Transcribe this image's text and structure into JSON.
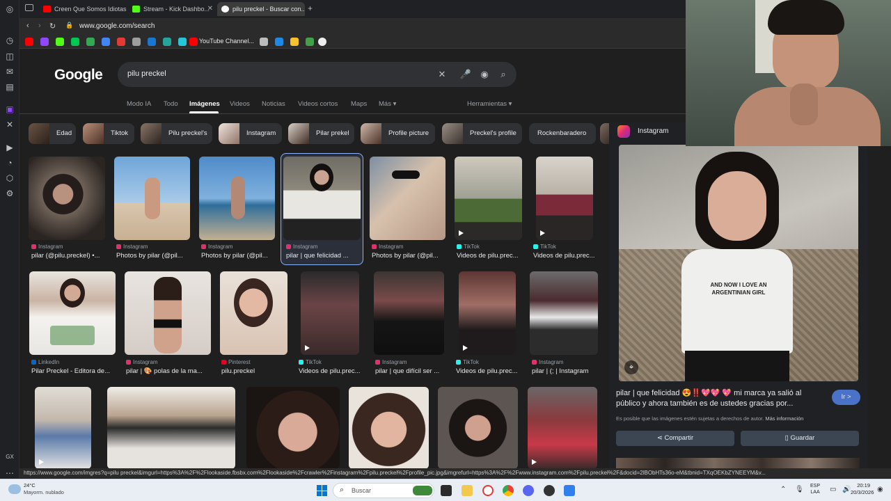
{
  "tabs": [
    {
      "title": "Creen Que Somos Idiotas"
    },
    {
      "title": "Stream - Kick Dashbo..."
    },
    {
      "title": "pilu preckel - Buscar con..."
    }
  ],
  "address_bar": {
    "url": "www.google.com/search"
  },
  "bookmarks": {
    "youtube_label": "YouTube Channel..."
  },
  "google": {
    "logo": "Google",
    "query": "pilu preckel",
    "nav": [
      "Modo IA",
      "Todo",
      "Imágenes",
      "Videos",
      "Noticias",
      "Videos cortos",
      "Maps",
      "Más ▾"
    ],
    "tools": "Herramientas ▾"
  },
  "chips": [
    "Edad",
    "Tiktok",
    "Pilu preckel's",
    "Instagram",
    "Pilar prekel",
    "Profile picture",
    "Preckel's profile",
    "Rockenbaradero"
  ],
  "results": {
    "row1": [
      {
        "source": "Instagram",
        "title": "pilar (@pilu.preckel) •..."
      },
      {
        "source": "Instagram",
        "title": "Photos by pilar (@pil..."
      },
      {
        "source": "Instagram",
        "title": "Photos by pilar (@pil..."
      },
      {
        "source": "Instagram",
        "title": "pilar | que felicidad ..."
      },
      {
        "source": "Instagram",
        "title": "Photos by pilar (@pil..."
      },
      {
        "source": "TikTok",
        "title": "Videos de pilu.prec..."
      },
      {
        "source": "TikTok",
        "title": "Videos de pilu.prec..."
      }
    ],
    "row2": [
      {
        "source": "LinkedIn",
        "title": "Pilar Preckel - Editora de..."
      },
      {
        "source": "Instagram",
        "title": "pilar | 🎨 polas de la ma..."
      },
      {
        "source": "Pinterest",
        "title": "pilu.preckel"
      },
      {
        "source": "TikTok",
        "title": "Videos de pilu.prec..."
      },
      {
        "source": "Instagram",
        "title": "pilar | que difícil ser ..."
      },
      {
        "source": "TikTok",
        "title": "Videos de pilu.prec..."
      },
      {
        "source": "Instagram",
        "title": "pilar | (; | Instagram"
      }
    ]
  },
  "side_panel": {
    "source": "Instagram",
    "shirt_text": "AND NOW I LOVE AN ARGENTINIAN GIRL",
    "title": "pilar | que felicidad 😍‼️💖💖 💖 mi marca ya salió al público y ahora también es de ustedes gracias por...",
    "copyright": "Es posible que las imágenes estén sujetas a derechos de autor.",
    "more_info": "Más información",
    "visit": "Ir >",
    "share": "Compartir",
    "save": "Guardar"
  },
  "status_url": "https://www.google.com/imgres?q=pilu preckel&imgurl=https%3A%2F%2Flookaside.fbsbx.com%2Flookaside%2Fcrawler%2Finstagram%2Fpilu.preckel%2Fprofile_pic.jpg&imgrefurl=https%3A%2F%2Fwww.instagram.com%2Fpilu.preckel%2F&docid=2lBObHTs36o-eM&tbnid=TXqOEKbZYNEEYM&v...",
  "taskbar": {
    "weather_temp": "24°C",
    "weather_desc": "Mayorm. nublado",
    "search_placeholder": "Buscar",
    "lang1": "ESP",
    "lang2": "LAA",
    "time": "20:19",
    "date": "20/3/2026"
  },
  "colors": {
    "accent": "#8ab4f8",
    "instagram": "#e1306c",
    "tiktok": "#25f4ee",
    "linkedin": "#0a66c2",
    "pinterest": "#e60023"
  }
}
